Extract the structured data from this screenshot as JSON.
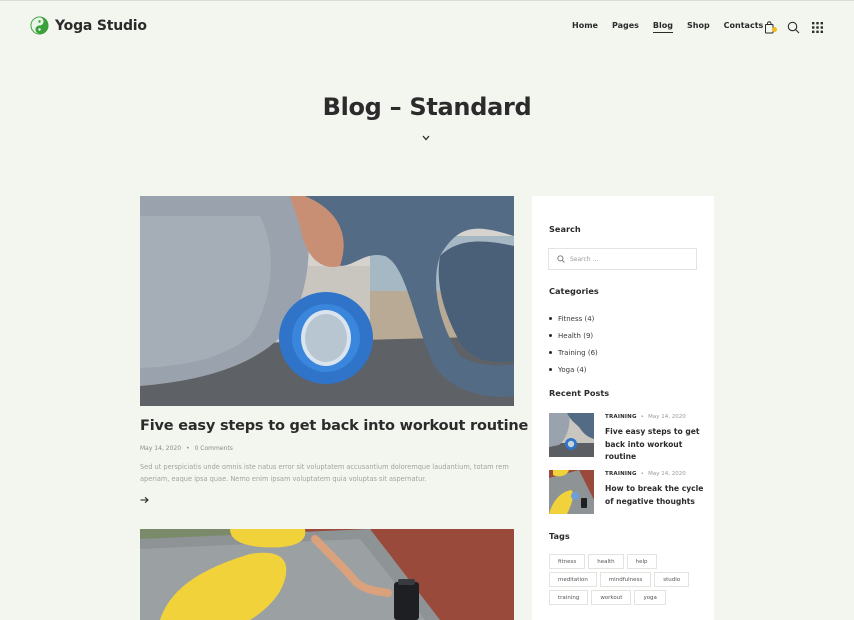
{
  "brand": {
    "name": "Yoga Studio",
    "accent": "#3aa03a"
  },
  "nav": [
    {
      "label": "Home",
      "active": false
    },
    {
      "label": "Pages",
      "active": false
    },
    {
      "label": "Blog",
      "active": true
    },
    {
      "label": "Shop",
      "active": false
    },
    {
      "label": "Contacts",
      "active": false
    }
  ],
  "header_icons": [
    "cart-icon",
    "search-icon",
    "grid-menu-icon"
  ],
  "page": {
    "title": "Blog – Standard"
  },
  "posts": [
    {
      "title": "Five easy steps to get back into workout routine",
      "date": "May 14, 2020",
      "comments": "0 Comments",
      "excerpt": "Sed ut perspiciatis unde omnis iste natus error sit voluptatem accusantium doloremque laudantium, totam rem aperiam, eaque ipsa quae. Nemo enim ipsam voluptatem quia voluptas sit aspernatur."
    },
    {}
  ],
  "sidebar": {
    "search": {
      "heading": "Search",
      "placeholder": "Search ..."
    },
    "categories": {
      "heading": "Categories",
      "items": [
        "Fitness (4)",
        "Health (9)",
        "Training (6)",
        "Yoga (4)"
      ]
    },
    "recent_posts": {
      "heading": "Recent Posts",
      "items": [
        {
          "category": "TRAINING",
          "date": "May 14, 2020",
          "title": "Five easy steps to get back into workout routine"
        },
        {
          "category": "TRAINING",
          "date": "May 14, 2020",
          "title": "How to break the cycle of negative thoughts"
        }
      ]
    },
    "tags": {
      "heading": "Tags",
      "items": [
        "fitness",
        "health",
        "help",
        "meditation",
        "mindfulness",
        "studio",
        "training",
        "workout",
        "yoga"
      ]
    }
  }
}
